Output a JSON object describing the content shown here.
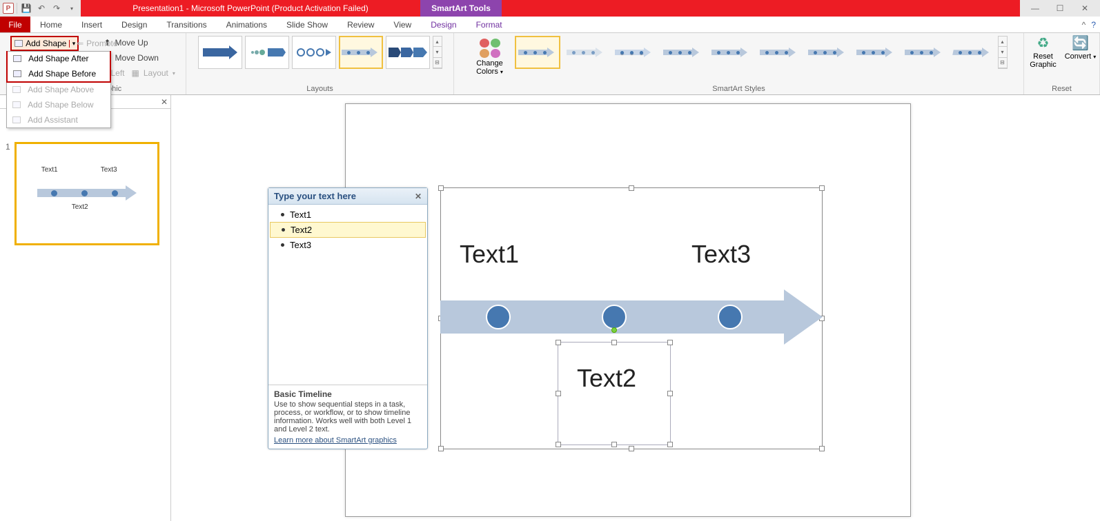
{
  "title_bar": {
    "doc_title": "Presentation1 - Microsoft PowerPoint (Product Activation Failed)",
    "context_title": "SmartArt Tools"
  },
  "tabs": {
    "file": "File",
    "home": "Home",
    "insert": "Insert",
    "design": "Design",
    "transitions": "Transitions",
    "animations": "Animations",
    "slideshow": "Slide Show",
    "review": "Review",
    "view": "View",
    "sa_design": "Design",
    "sa_format": "Format"
  },
  "ribbon": {
    "add_shape": "Add Shape",
    "promote": "Promote",
    "move_up": "Move Up",
    "move_down": "Move Down",
    "right_to_left": "o Left",
    "layout_btn": "Layout",
    "group_graphic": "phic",
    "group_layouts": "Layouts",
    "change_colors": "Change Colors",
    "group_styles": "SmartArt Styles",
    "reset_graphic": "Reset Graphic",
    "convert": "Convert",
    "group_reset": "Reset"
  },
  "add_shape_menu": {
    "after": "Add Shape After",
    "before": "Add Shape Before",
    "above": "Add Shape Above",
    "below": "Add Shape Below",
    "assistant": "Add Assistant"
  },
  "slide_thumb": {
    "num": "1",
    "t1": "Text1",
    "t2": "Text2",
    "t3": "Text3"
  },
  "text_pane": {
    "header": "Type your text here",
    "items": [
      "Text1",
      "Text2",
      "Text3"
    ],
    "footer_title": "Basic Timeline",
    "footer_desc": "Use to show sequential steps in a task, process, or workflow, or to show timeline information. Works well with both Level 1 and Level 2 text.",
    "footer_link": "Learn more about SmartArt graphics"
  },
  "smartart": {
    "t1": "Text1",
    "t2": "Text2",
    "t3": "Text3"
  },
  "colors": {
    "accent": "#4678b0",
    "arrow": "#b8c8dc",
    "sel_border": "#f0b000",
    "red": "#ed1c24"
  }
}
